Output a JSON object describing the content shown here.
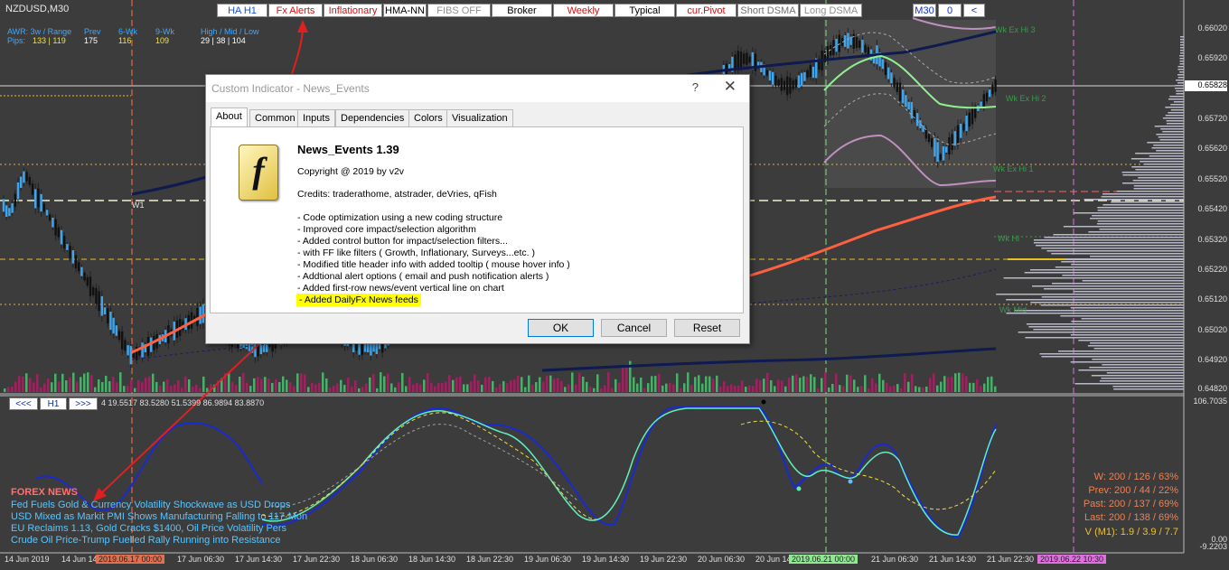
{
  "window": {
    "symbol": "NZDUSD,M30"
  },
  "header": {
    "awr_label": "AWR: 3w / Range",
    "pips_label": "Pips:",
    "awr_values": "133 | 119",
    "prev_label": "Prev",
    "prev_value": "175",
    "wk6_label": "6-Wk",
    "wk6_value": "116",
    "wk9_label": "9-Wk",
    "wk9_value": "109",
    "hml_label": "High / Mid / Low",
    "hml_value": "29 | 38 | 104"
  },
  "toolbar": [
    {
      "label": "HA H1",
      "color": "#1c4fd0"
    },
    {
      "label": "Fx Alerts",
      "color": "#d01010"
    },
    {
      "label": "Inflationary",
      "color": "#d01010"
    },
    {
      "label": "HMA-NN",
      "color": "#000000"
    },
    {
      "label": "FIBS OFF",
      "color": "#909090"
    },
    {
      "label": "Broker",
      "color": "#000000"
    },
    {
      "label": "Weekly",
      "color": "#d01010"
    },
    {
      "label": "Typical",
      "color": "#000000"
    },
    {
      "label": "cur.Pivot",
      "color": "#d01010"
    },
    {
      "label": "Short DSMA",
      "color": "#707070"
    },
    {
      "label": "Long DSMA",
      "color": "#909090"
    }
  ],
  "timeframe_controls": {
    "tf": "M30",
    "shift": "0",
    "back": "<"
  },
  "price_axis": [
    "0.66020",
    "0.65920",
    "0.65820",
    "0.65720",
    "0.65620",
    "0.65520",
    "0.65420",
    "0.65320",
    "0.65220",
    "0.65120",
    "0.65020",
    "0.64920",
    "0.64820"
  ],
  "current_price": "0.65828",
  "indicator_axis": {
    "max": "106.7035",
    "zero": "0.00",
    "min": "-9.2203"
  },
  "time_axis": [
    "14 Jun 2019",
    "14 Jun 14",
    "17 Jun 06:30",
    "17 Jun 14:30",
    "17 Jun 22:30",
    "18 Jun 06:30",
    "18 Jun 14:30",
    "18 Jun 22:30",
    "19 Jun 06:30",
    "19 Jun 14:30",
    "19 Jun 22:30",
    "20 Jun 06:30",
    "20 Jun 14",
    "21 Jun 06:30",
    "21 Jun 14:30",
    "21 Jun 22:30"
  ],
  "time_flags": [
    {
      "label": "2019.06.17 00:00",
      "bg": "#e07050"
    },
    {
      "label": "2019.06.21 00:00",
      "bg": "#90e890"
    },
    {
      "label": "2019.06.22 10:30",
      "bg": "#e070e0"
    }
  ],
  "chart_labels": {
    "w1": "W1",
    "wk_ex_hi3": "Wk Ex Hi 3",
    "wk_ex_hi2": "Wk Ex Hi 2",
    "wk_ex_hi1": "Wk Ex Hi 1",
    "wk_hi": "Wk Hi",
    "wk_mid": "Wk Mid"
  },
  "subwindow": {
    "prev_btn": "<<<",
    "tf_btn": "H1",
    "next_btn": ">>>",
    "values": "4 19.5517 83.5280 51.5399 86.9894 83.8870"
  },
  "news": {
    "title": "FOREX NEWS",
    "items": [
      "Fed Fuels Gold & Currency Volatility Shockwave as USD Drops",
      "USD Mixed as Markit PMI Shows Manufacturing Falling to 117-Mon",
      "EU Reclaims 1.13, Gold Cracks $1400, Oil Price Volatility Pers",
      "Crude Oil Price-Trump Fuelled Rally Running into Resistance"
    ]
  },
  "stats": [
    {
      "text": "W: 200 / 126 / 63%",
      "color": "#f08050"
    },
    {
      "text": "Prev: 200 / 44 / 22%",
      "color": "#f08050"
    },
    {
      "text": "Past: 200 / 137 / 69%",
      "color": "#f08050"
    },
    {
      "text": "Last: 200 / 138 / 69%",
      "color": "#f08050"
    },
    {
      "text": "V (M1): 1.9 / 3.9 / 7.7",
      "color": "#f0c030"
    }
  ],
  "dialog": {
    "title": "Custom Indicator - News_Events",
    "help": "?",
    "close": "✕",
    "tabs": [
      "About",
      "Common",
      "Inputs",
      "Dependencies",
      "Colors",
      "Visualization"
    ],
    "name": "News_Events 1.39",
    "copyright": "Copyright @ 2019 by v2v",
    "credits": "Credits: traderathome, atstrader, deVries, qFish",
    "changes": [
      "- Code optimization using a new coding structure",
      "- Improved core impact/selection algorithm",
      "- Added control button for impact/selection filters...",
      "- with FF like filters ( Growth, Inflationary, Surveys...etc. )",
      "- Modified title header info with added tooltip ( mouse hover info )",
      "- Addtional alert options ( email and push notification alerts )",
      "- Added first-row news/event vertical line on chart"
    ],
    "highlight_prefix": "- ",
    "highlight": "Added DailyFx News feeds",
    "icon": "f",
    "ok": "OK",
    "cancel": "Cancel",
    "reset": "Reset"
  }
}
